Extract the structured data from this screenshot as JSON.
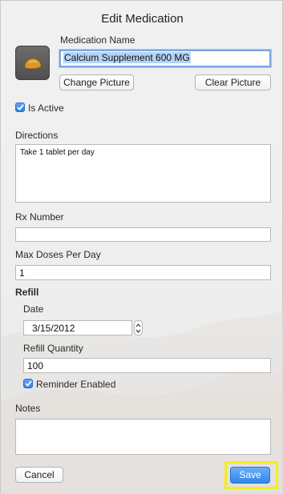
{
  "dialog": {
    "title": "Edit Medication"
  },
  "medication": {
    "name_label": "Medication Name",
    "name_value": "Calcium Supplement 600 MG",
    "change_picture_label": "Change Picture",
    "clear_picture_label": "Clear Picture",
    "is_active_label": "Is Active",
    "is_active": true
  },
  "directions": {
    "label": "Directions",
    "value": "Take 1 tablet per day"
  },
  "rx": {
    "label": "Rx Number",
    "value": ""
  },
  "max_doses": {
    "label": "Max Doses Per Day",
    "value": "1"
  },
  "refill": {
    "heading": "Refill",
    "date_label": "Date",
    "date_value": "3/15/2012",
    "quantity_label": "Refill Quantity",
    "quantity_value": "100",
    "reminder_label": "Reminder Enabled",
    "reminder_enabled": true
  },
  "notes": {
    "label": "Notes",
    "value": ""
  },
  "footer": {
    "cancel_label": "Cancel",
    "save_label": "Save"
  },
  "colors": {
    "accent": "#2f86ec",
    "highlight": "#f2ef1b"
  }
}
